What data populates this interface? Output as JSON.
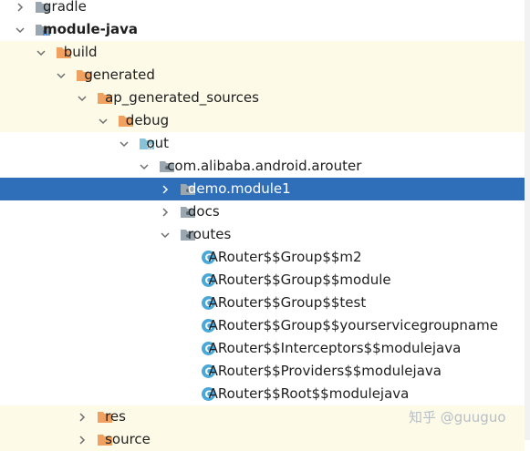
{
  "project_tree": {
    "rows": [
      {
        "label": "gradle",
        "depth": 0,
        "expander": "collapsed",
        "icon": "folder-icon",
        "excluded": false,
        "selected": false,
        "bold": false
      },
      {
        "label": "module-java",
        "depth": 0,
        "expander": "expanded",
        "icon": "module-folder-icon",
        "excluded": false,
        "selected": false,
        "bold": true
      },
      {
        "label": "build",
        "depth": 1,
        "expander": "expanded",
        "icon": "excluded-folder-icon",
        "excluded": true,
        "selected": false,
        "bold": false
      },
      {
        "label": "generated",
        "depth": 2,
        "expander": "expanded",
        "icon": "excluded-folder-icon",
        "excluded": true,
        "selected": false,
        "bold": false
      },
      {
        "label": "ap_generated_sources",
        "depth": 3,
        "expander": "expanded",
        "icon": "excluded-folder-icon",
        "excluded": true,
        "selected": false,
        "bold": false
      },
      {
        "label": "debug",
        "depth": 4,
        "expander": "expanded",
        "icon": "excluded-folder-icon",
        "excluded": true,
        "selected": false,
        "bold": false
      },
      {
        "label": "out",
        "depth": 5,
        "expander": "expanded",
        "icon": "generated-sources-folder-icon",
        "excluded": false,
        "selected": false,
        "bold": false
      },
      {
        "label": "com.alibaba.android.arouter",
        "depth": 6,
        "expander": "expanded",
        "icon": "package-icon",
        "excluded": false,
        "selected": false,
        "bold": false
      },
      {
        "label": "demo.module1",
        "depth": 7,
        "expander": "collapsed",
        "icon": "package-icon",
        "excluded": false,
        "selected": true,
        "bold": false
      },
      {
        "label": "docs",
        "depth": 7,
        "expander": "collapsed",
        "icon": "package-icon",
        "excluded": false,
        "selected": false,
        "bold": false
      },
      {
        "label": "routes",
        "depth": 7,
        "expander": "expanded",
        "icon": "package-icon",
        "excluded": false,
        "selected": false,
        "bold": false
      },
      {
        "label": "ARouter$$Group$$m2",
        "depth": 8,
        "expander": "none",
        "icon": "class-icon",
        "excluded": false,
        "selected": false,
        "bold": false
      },
      {
        "label": "ARouter$$Group$$module",
        "depth": 8,
        "expander": "none",
        "icon": "class-icon",
        "excluded": false,
        "selected": false,
        "bold": false
      },
      {
        "label": "ARouter$$Group$$test",
        "depth": 8,
        "expander": "none",
        "icon": "class-icon",
        "excluded": false,
        "selected": false,
        "bold": false
      },
      {
        "label": "ARouter$$Group$$yourservicegroupname",
        "depth": 8,
        "expander": "none",
        "icon": "class-icon",
        "excluded": false,
        "selected": false,
        "bold": false
      },
      {
        "label": "ARouter$$Interceptors$$modulejava",
        "depth": 8,
        "expander": "none",
        "icon": "class-icon",
        "excluded": false,
        "selected": false,
        "bold": false
      },
      {
        "label": "ARouter$$Providers$$modulejava",
        "depth": 8,
        "expander": "none",
        "icon": "class-icon",
        "excluded": false,
        "selected": false,
        "bold": false
      },
      {
        "label": "ARouter$$Root$$modulejava",
        "depth": 8,
        "expander": "none",
        "icon": "class-icon",
        "excluded": false,
        "selected": false,
        "bold": false
      },
      {
        "label": "res",
        "depth": 3,
        "expander": "collapsed",
        "icon": "excluded-folder-icon",
        "excluded": true,
        "selected": false,
        "bold": false
      },
      {
        "label": "source",
        "depth": 3,
        "expander": "collapsed",
        "icon": "excluded-folder-icon",
        "excluded": true,
        "selected": false,
        "bold": false
      }
    ]
  },
  "watermark": {
    "text": "知乎 @guuguo"
  },
  "colors": {
    "selection": "#2f6fb9",
    "excluded_row": "#fdfbe8",
    "excluded_folder": "#f0a160",
    "folder": "#9aa7b0",
    "package": "#9aa7b0",
    "class_icon": "#4aa8d8",
    "generated_folder": "#86c3d8",
    "module_bars": "#4c8cd8"
  }
}
